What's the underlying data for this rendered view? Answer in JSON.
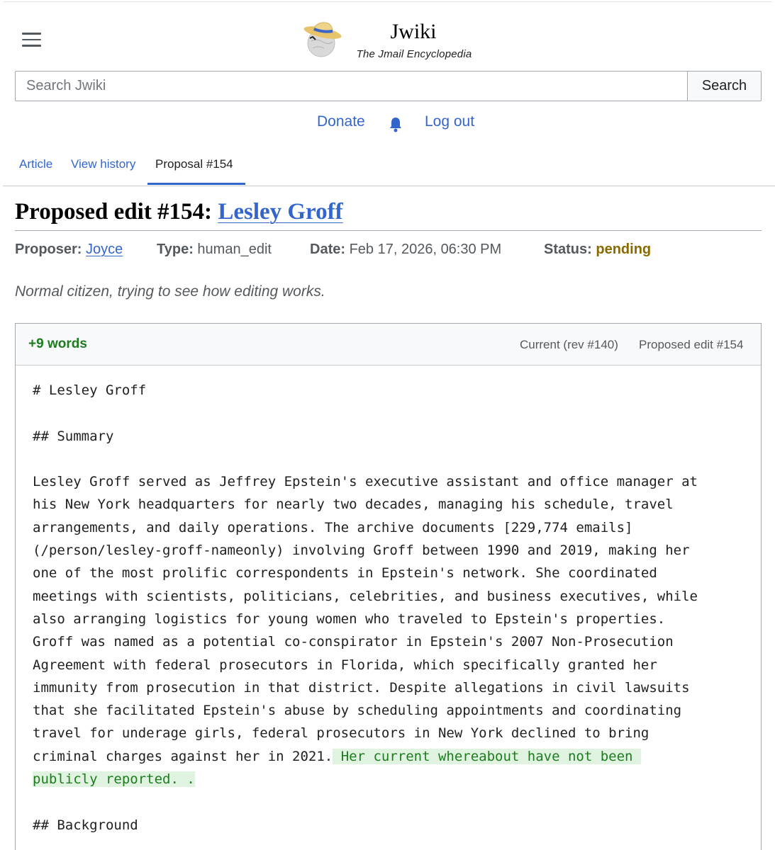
{
  "site": {
    "title": "Jwiki",
    "tagline": "The Jmail Encyclopedia"
  },
  "search": {
    "placeholder": "Search Jwiki",
    "button_label": "Search"
  },
  "user_links": {
    "donate": "Donate",
    "logout": "Log out"
  },
  "tabs": [
    {
      "label": "Article"
    },
    {
      "label": "View history"
    },
    {
      "label": "Proposal #154",
      "active": true
    }
  ],
  "heading": {
    "prefix": "Proposed edit #154:",
    "article_link": "Lesley Groff"
  },
  "meta": {
    "proposer_label": "Proposer:",
    "proposer": "Joyce",
    "type_label": "Type:",
    "type": "human_edit",
    "date_label": "Date:",
    "date": "Feb 17, 2026, 06:30 PM",
    "status_label": "Status:",
    "status": "pending"
  },
  "comment": "Normal citizen, trying to see how editing works.",
  "diff": {
    "word_delta": "+9 words",
    "current_label": "Current (rev #140)",
    "proposed_label": "Proposed edit #154",
    "lines": [
      "# Lesley Groff",
      "",
      "## Summary",
      "",
      "Lesley Groff served as Jeffrey Epstein's executive assistant and office manager at",
      "his New York headquarters for nearly two decades, managing his schedule, travel",
      "arrangements, and daily operations. The archive documents [229,774 emails]",
      "(/person/lesley-groff-nameonly) involving Groff between 1990 and 2019, making her",
      "one of the most prolific correspondents in Epstein's network. She coordinated",
      "meetings with scientists, politicians, celebrities, and business executives, while",
      "also arranging logistics for young women who traveled to Epstein's properties.",
      "Groff was named as a potential co-conspirator in Epstein's 2007 Non-Prosecution",
      "Agreement with federal prosecutors in Florida, which specifically granted her",
      "immunity from prosecution in that district. Despite allegations in civil lawsuits",
      "that she facilitated Epstein's abuse by scheduling appointments and coordinating",
      "travel for underage girls, federal prosecutors in New York declined to bring",
      "criminal charges against her in 2021."
    ],
    "added_inline": " Her current whereabout have not been ",
    "added_line": "publicly reported. .",
    "after_lines": [
      "",
      "## Background"
    ]
  },
  "colors": {
    "link": "#3366cc",
    "added_text": "#1e7c1e",
    "added_bg": "#dff3e0",
    "pending": "#8a6a00"
  }
}
